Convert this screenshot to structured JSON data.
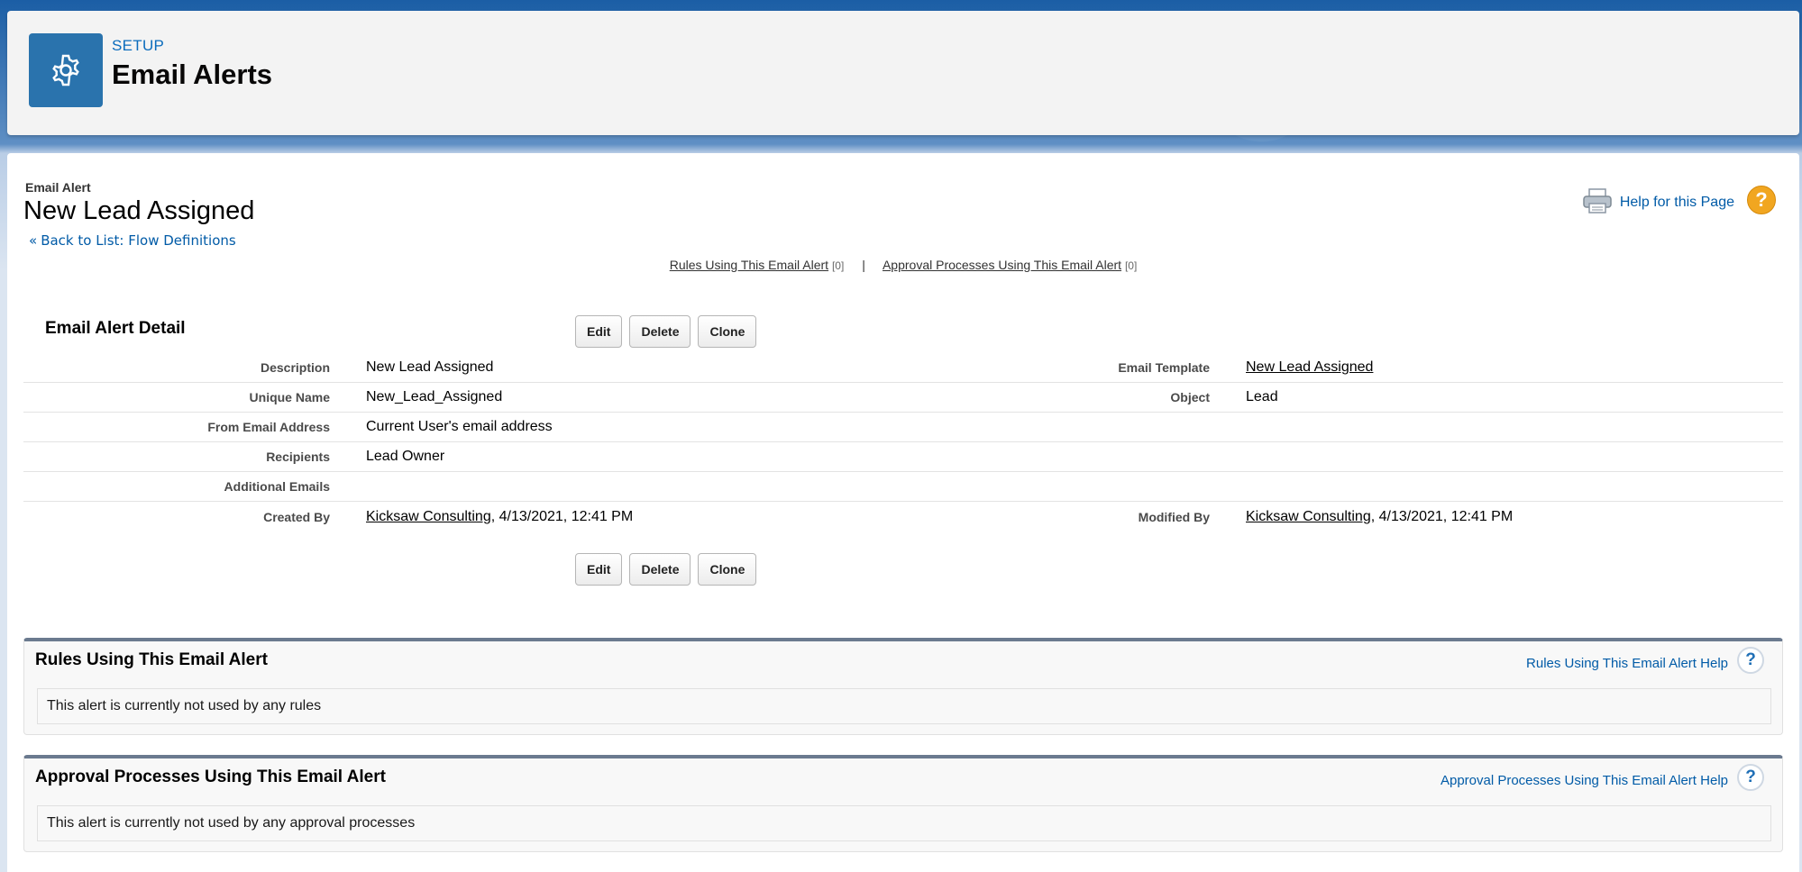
{
  "header": {
    "section": "SETUP",
    "title": "Email Alerts",
    "icon": "gear-icon"
  },
  "page": {
    "type_label": "Email Alert",
    "title": "New Lead Assigned",
    "back_link": "Back to List: Flow Definitions",
    "back_arrow": "«",
    "help_link": "Help for this Page",
    "help_icon": "?"
  },
  "related_links": {
    "rules_label": "Rules Using This Email Alert",
    "rules_count": "[0]",
    "separator": "|",
    "approval_label": "Approval Processes Using This Email Alert",
    "approval_count": "[0]"
  },
  "detail": {
    "title": "Email Alert Detail",
    "buttons": {
      "edit": "Edit",
      "delete": "Delete",
      "clone": "Clone"
    },
    "rows": [
      {
        "label": "Description",
        "value": "New Lead Assigned",
        "label2": "Email Template",
        "value2": "New Lead Assigned"
      },
      {
        "label": "Unique Name",
        "value": "New_Lead_Assigned",
        "label2": "Object",
        "value2": "Lead"
      },
      {
        "label": "From Email Address",
        "value": "Current User's email address",
        "label2": "",
        "value2": ""
      },
      {
        "label": "Recipients",
        "value": "Lead Owner",
        "label2": "",
        "value2": ""
      },
      {
        "label": "Additional Emails",
        "value": "",
        "label2": "",
        "value2": ""
      }
    ],
    "created": {
      "label": "Created By",
      "user": "Kicksaw Consulting",
      "date": ", 4/13/2021, 12:41 PM"
    },
    "modified": {
      "label": "Modified By",
      "user": "Kicksaw Consulting",
      "date": ", 4/13/2021, 12:41 PM"
    }
  },
  "rules_block": {
    "title": "Rules Using This Email Alert",
    "help": "Rules Using This Email Alert Help",
    "help_icon": "?",
    "body": "This alert is currently not used by any rules"
  },
  "approval_block": {
    "title": "Approval Processes Using This Email Alert",
    "help": "Approval Processes Using This Email Alert Help",
    "help_icon": "?",
    "body": "This alert is currently not used by any approval processes"
  },
  "colors": {
    "brand_blue": "#2a73ad",
    "link": "#015ba7",
    "help_orange": "#f1a620"
  }
}
